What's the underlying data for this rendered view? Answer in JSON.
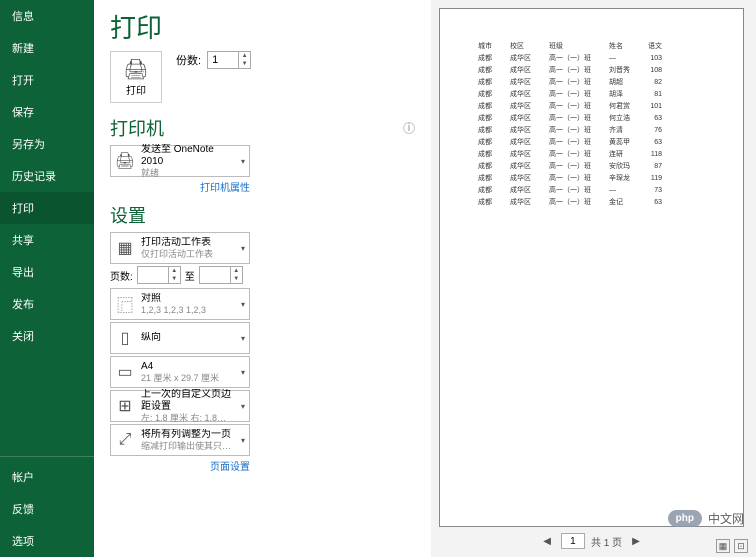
{
  "sidebar": {
    "items": [
      "信息",
      "新建",
      "打开",
      "保存",
      "另存为",
      "历史记录",
      "打印",
      "共享",
      "导出",
      "发布",
      "关闭"
    ],
    "footer": [
      "帐户",
      "反馈",
      "选项"
    ],
    "activeIndex": 6
  },
  "page_title": "打印",
  "print_button_label": "打印",
  "copies_label": "份数:",
  "copies_value": "1",
  "printer_section_title": "打印机",
  "printer": {
    "name": "发送至 OneNote 2010",
    "status": "就绪"
  },
  "printer_properties_link": "打印机属性",
  "settings_section_title": "设置",
  "settings": {
    "active_sheets": {
      "title": "打印活动工作表",
      "sub": "仅打印活动工作表"
    },
    "pages_label": "页数:",
    "pages_to": "至",
    "collate": {
      "title": "对照",
      "sub": "1,2,3    1,2,3    1,2,3"
    },
    "orientation": {
      "title": "纵向",
      "sub": ""
    },
    "paper": {
      "title": "A4",
      "sub": "21 厘米 x 29.7 厘米"
    },
    "margins": {
      "title": "上一次的自定义页边距设置",
      "sub": "左: 1.8 厘米   右: 1.8…"
    },
    "scaling": {
      "title": "将所有列调整为一页",
      "sub": "缩减打印输出使其只有一…"
    }
  },
  "page_setup_link": "页面设置",
  "preview": {
    "columns": [
      "城市",
      "校区",
      "班级",
      "姓名",
      "语文"
    ],
    "rows": [
      [
        "成都",
        "成华区",
        "高一（一）班",
        "—",
        "103"
      ],
      [
        "成都",
        "成华区",
        "高一（一）班",
        "刘晋秀",
        "108"
      ],
      [
        "成都",
        "成华区",
        "高一（一）班",
        "胡超",
        "82"
      ],
      [
        "成都",
        "成华区",
        "高一（一）班",
        "胡泽",
        "81"
      ],
      [
        "成都",
        "成华区",
        "高一（一）班",
        "何君赏",
        "101"
      ],
      [
        "成都",
        "成华区",
        "高一（一）班",
        "何立浩",
        "63"
      ],
      [
        "成都",
        "成华区",
        "高一（一）班",
        "齐清",
        "76"
      ],
      [
        "成都",
        "成华区",
        "高一（一）班",
        "黄蕊甲",
        "63"
      ],
      [
        "成都",
        "成华区",
        "高一（一）班",
        "连研",
        "118"
      ],
      [
        "成都",
        "成华区",
        "高一（一）班",
        "安欣玛",
        "87"
      ],
      [
        "成都",
        "成华区",
        "高一（一）班",
        "辛琛龙",
        "119"
      ],
      [
        "成都",
        "成华区",
        "高一（一）班",
        "—",
        "73"
      ],
      [
        "成都",
        "成华区",
        "高一（一）班",
        "金记",
        "63"
      ]
    ],
    "nav": {
      "current": "1",
      "total_label": "共 1 页"
    }
  },
  "watermark": {
    "badge": "php",
    "text": "中文网"
  }
}
